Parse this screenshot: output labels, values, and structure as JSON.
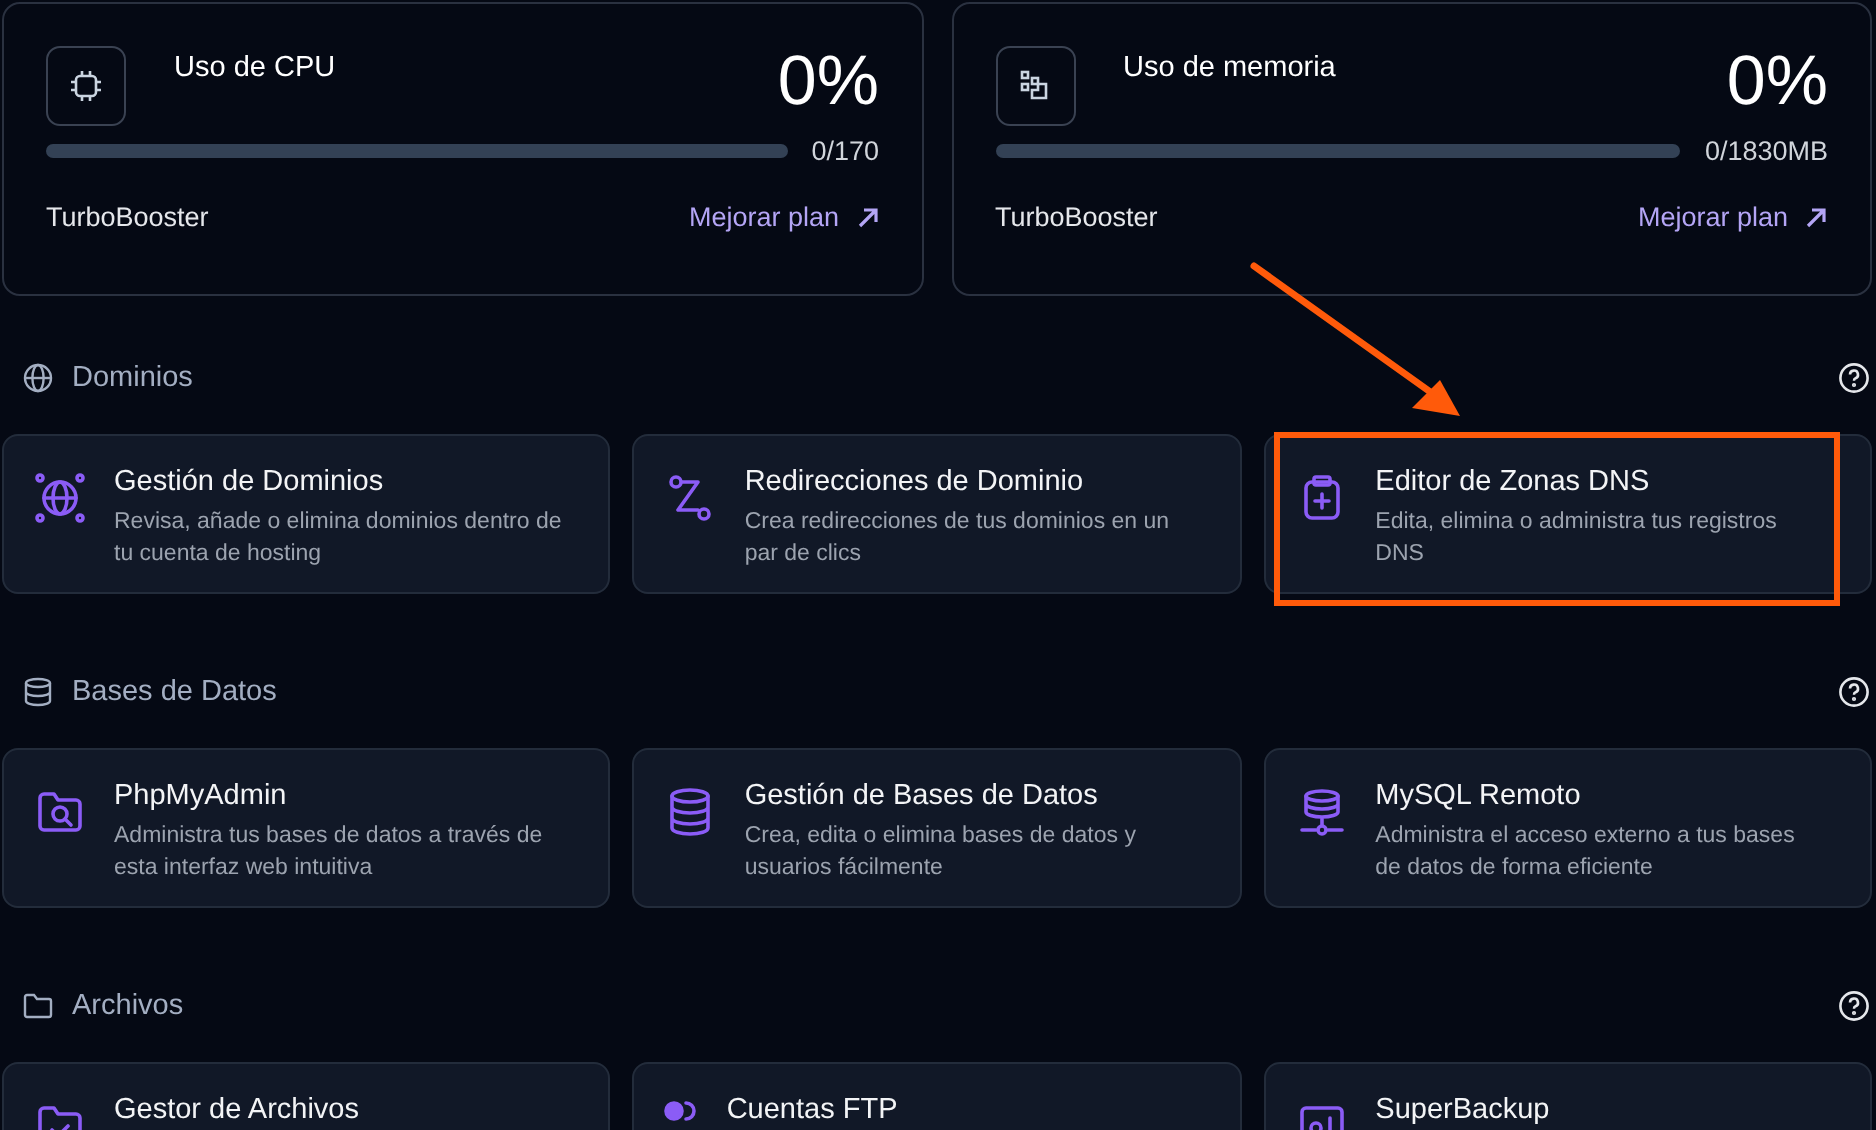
{
  "usage_cards": [
    {
      "title": "Uso de CPU",
      "percent": "0%",
      "level": 0,
      "reading": "0/170",
      "plan": "TurboBooster",
      "link": "Mejorar plan"
    },
    {
      "title": "Uso de memoria",
      "percent": "0%",
      "level": 0,
      "reading": "0/1830MB",
      "plan": "TurboBooster",
      "link": "Mejorar plan"
    }
  ],
  "sections": [
    {
      "title": "Dominios",
      "cards": [
        {
          "title": "Gestión de Dominios",
          "description": "Revisa, añade o elimina dominios dentro de tu cuenta de hosting",
          "highlighted": false
        },
        {
          "title": "Redirecciones de Dominio",
          "description": "Crea redirecciones de tus dominios en un par de clics",
          "highlighted": false
        },
        {
          "title": "Editor de Zonas DNS",
          "description": "Edita, elimina o administra tus registros DNS",
          "highlighted": true
        }
      ]
    },
    {
      "title": "Bases de Datos",
      "cards": [
        {
          "title": "PhpMyAdmin",
          "description": "Administra tus bases de datos a través de esta interfaz web intuitiva",
          "highlighted": false
        },
        {
          "title": "Gestión de Bases de Datos",
          "description": "Crea, edita o elimina bases de datos y usuarios fácilmente",
          "highlighted": false
        },
        {
          "title": "MySQL Remoto",
          "description": "Administra el acceso externo a tus bases de datos de forma eficiente",
          "highlighted": false
        }
      ]
    },
    {
      "title": "Archivos",
      "cards": [
        {
          "title": "Gestor de Archivos",
          "highlighted": false
        },
        {
          "title": "Cuentas FTP",
          "highlighted": false
        },
        {
          "title": "SuperBackup",
          "highlighted": false
        }
      ]
    }
  ]
}
